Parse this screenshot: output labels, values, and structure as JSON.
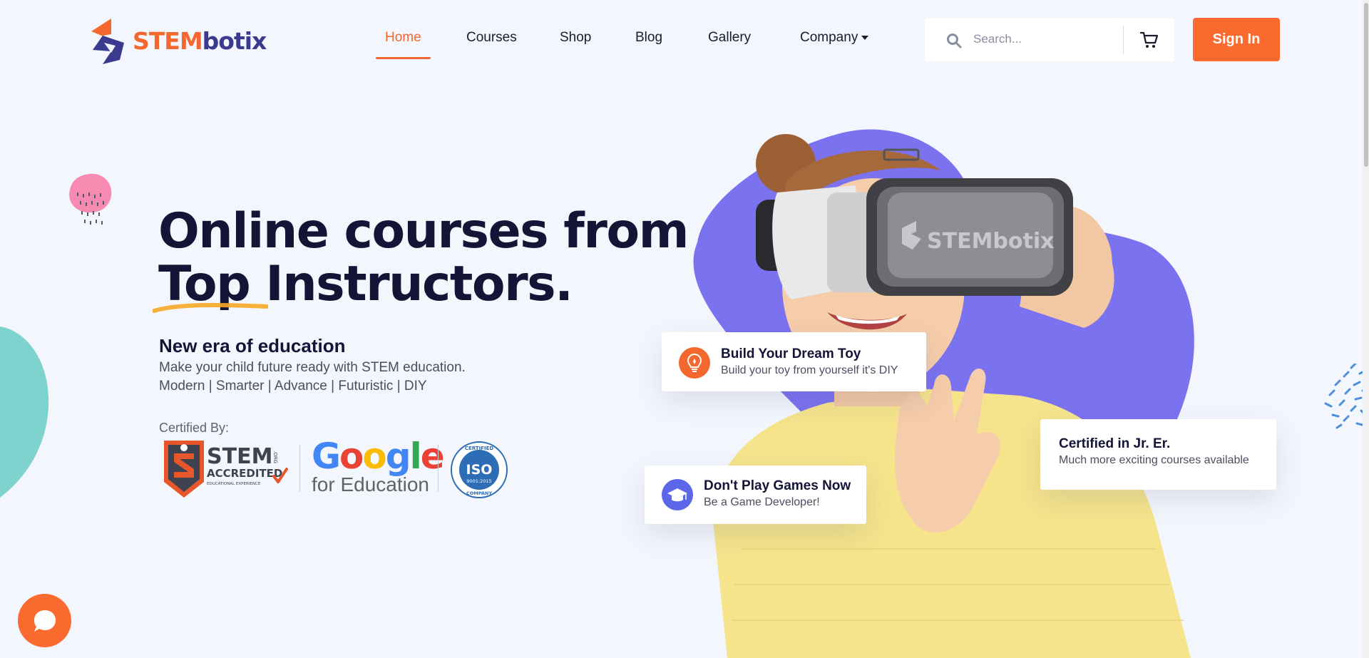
{
  "brand": {
    "name_part1": "STEM",
    "name_part2": "botix"
  },
  "nav": {
    "items": [
      {
        "label": "Home",
        "active": true
      },
      {
        "label": "Courses"
      },
      {
        "label": "Shop"
      },
      {
        "label": "Blog"
      },
      {
        "label": "Gallery"
      },
      {
        "label": "Company"
      }
    ]
  },
  "search": {
    "placeholder": "Search..."
  },
  "signin_label": "Sign In",
  "hero": {
    "headline_line1": "Online courses from",
    "headline_top": "Top",
    "headline_rest": " Instructors.",
    "subheading": "New era of education",
    "description1": "Make your child future ready with STEM education.",
    "description2": "Modern | Smarter | Advance | Futuristic | DIY",
    "certified_label": "Certified By:",
    "stem_badge": {
      "line1": "STEM",
      "line2": "ACCREDITED",
      "line3": "EDUCATIONAL EXPERIENCE",
      "side": ".ORG"
    },
    "google": {
      "letters": [
        "G",
        "o",
        "o",
        "g",
        "l",
        "e"
      ],
      "subtitle": "for Education"
    },
    "iso": {
      "top": "CERTIFIED",
      "mid": "ISO",
      "num": "9001:2015",
      "bottom": "COMPANY"
    },
    "headset_brand": "STEMbotix"
  },
  "cards": {
    "dream_toy": {
      "title": "Build Your Dream Toy",
      "subtitle": "Build your toy from yourself it's DIY"
    },
    "games": {
      "title": "Don't Play Games Now",
      "subtitle": "Be a Game Developer!"
    },
    "certified": {
      "title": "Certified in Jr. Er.",
      "subtitle": "Much more exciting courses available"
    }
  },
  "colors": {
    "accent": "#fb6a2f",
    "navy": "#141437",
    "purple_blob": "#7b72f0",
    "teal": "#7fd3cf",
    "pink": "#f78ab0",
    "sweater": "#f5e48c",
    "background": "#f3f6fc"
  },
  "icons": {
    "search": "search-icon",
    "cart": "cart-icon",
    "bulb": "lightbulb-icon",
    "cap": "graduation-cap-icon",
    "chat": "chat-icon",
    "caret": "caret-down-icon"
  }
}
